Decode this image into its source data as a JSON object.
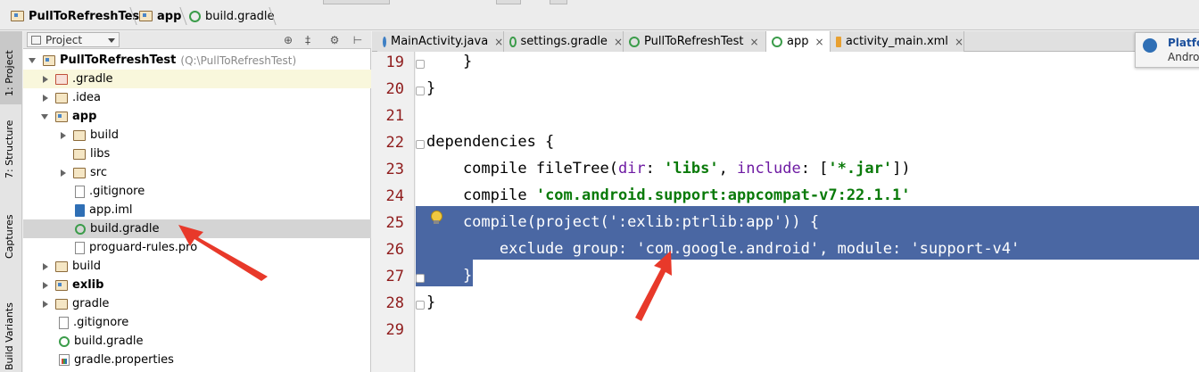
{
  "breadcrumb": {
    "project": "PullToRefreshTest",
    "module": "app",
    "file": "build.gradle"
  },
  "tool_windows": {
    "project": "1: Project",
    "structure": "7: Structure",
    "captures": "Captures",
    "build_variants": "Build Variants"
  },
  "project_panel": {
    "view_selector": "Project",
    "root": {
      "name": "PullToRefreshTest",
      "path": "(Q:\\PullToRefreshTest)"
    },
    "items": [
      {
        "label": ".gradle"
      },
      {
        "label": ".idea"
      },
      {
        "label": "app"
      },
      {
        "label": "build"
      },
      {
        "label": "libs"
      },
      {
        "label": "src"
      },
      {
        "label": ".gitignore"
      },
      {
        "label": "app.iml"
      },
      {
        "label": "build.gradle"
      },
      {
        "label": "proguard-rules.pro"
      },
      {
        "label": "build"
      },
      {
        "label": "exlib"
      },
      {
        "label": "gradle"
      },
      {
        "label": ".gitignore"
      },
      {
        "label": "build.gradle"
      },
      {
        "label": "gradle.properties"
      }
    ]
  },
  "editor_tabs": [
    {
      "label": "MainActivity.java"
    },
    {
      "label": "settings.gradle"
    },
    {
      "label": "PullToRefreshTest"
    },
    {
      "label": "app"
    },
    {
      "label": "activity_main.xml"
    }
  ],
  "tab_close_glyph": "×",
  "editor": {
    "lines": [
      {
        "num": "19",
        "text": "    }"
      },
      {
        "num": "20",
        "text": "}"
      },
      {
        "num": "21",
        "text": ""
      },
      {
        "num": "22",
        "text": "dependencies {"
      },
      {
        "num": "23",
        "a": "    compile fileTree(",
        "b": "dir",
        "c": ": ",
        "d": "'libs'",
        "e": ", ",
        "f": "include",
        "g": ": [",
        "h": "'*.jar'",
        "i": "])"
      },
      {
        "num": "24",
        "a": "    compile ",
        "d": "'com.android.support:appcompat-v7:22.1.1'"
      },
      {
        "num": "25",
        "text": "    compile(project(':exlib:ptrlib:app')) {"
      },
      {
        "num": "26",
        "text": "        exclude group: 'com.google.android', module: 'support-v4'"
      },
      {
        "num": "27",
        "text": "    }"
      },
      {
        "num": "28",
        "text": "}"
      },
      {
        "num": "29",
        "text": ""
      }
    ]
  },
  "notification": {
    "title": "Platfo",
    "subtitle": "Androi"
  },
  "colors": {
    "selection": "#4a67a3",
    "line_number": "#8f1c1c",
    "string": "#0a7a0a",
    "annotation_arrow": "#e8392a"
  }
}
